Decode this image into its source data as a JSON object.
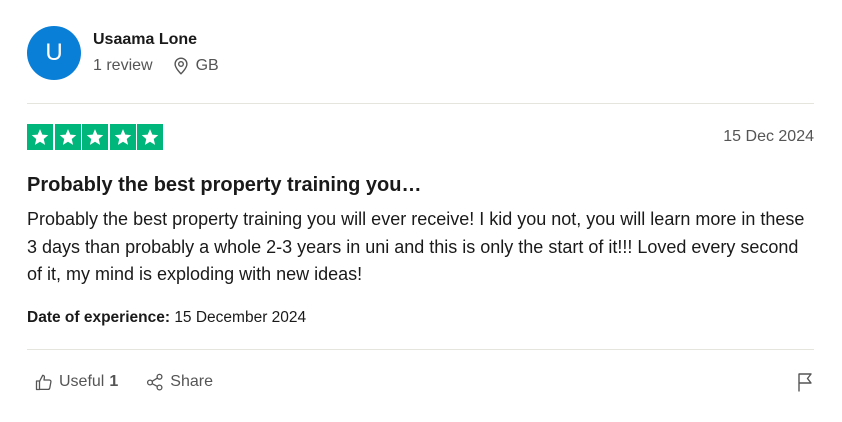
{
  "reviewer": {
    "avatar_initial": "U",
    "name": "Usaama Lone",
    "review_count": "1 review",
    "country": "GB"
  },
  "review": {
    "rating": 5,
    "rating_max": 5,
    "date": "15 Dec 2024",
    "title": "Probably the best property training you…",
    "text": "Probably the best property training you will ever receive! I kid you not, you will learn more in these 3 days than probably a whole 2-3 years in uni and this is only the start of it!!! Loved every second of it, my mind is exploding with new ideas!",
    "experience_label": "Date of experience:",
    "experience_date": "15 December 2024"
  },
  "actions": {
    "useful_label": "Useful",
    "useful_count": "1",
    "share_label": "Share"
  },
  "colors": {
    "avatar": "#0a7fd8",
    "star": "#00b67a",
    "divider": "#e5e5dd"
  },
  "icons": {
    "location": "location-pin-icon",
    "star": "star-icon",
    "useful": "thumbs-up-icon",
    "share": "share-icon",
    "flag": "flag-icon"
  }
}
